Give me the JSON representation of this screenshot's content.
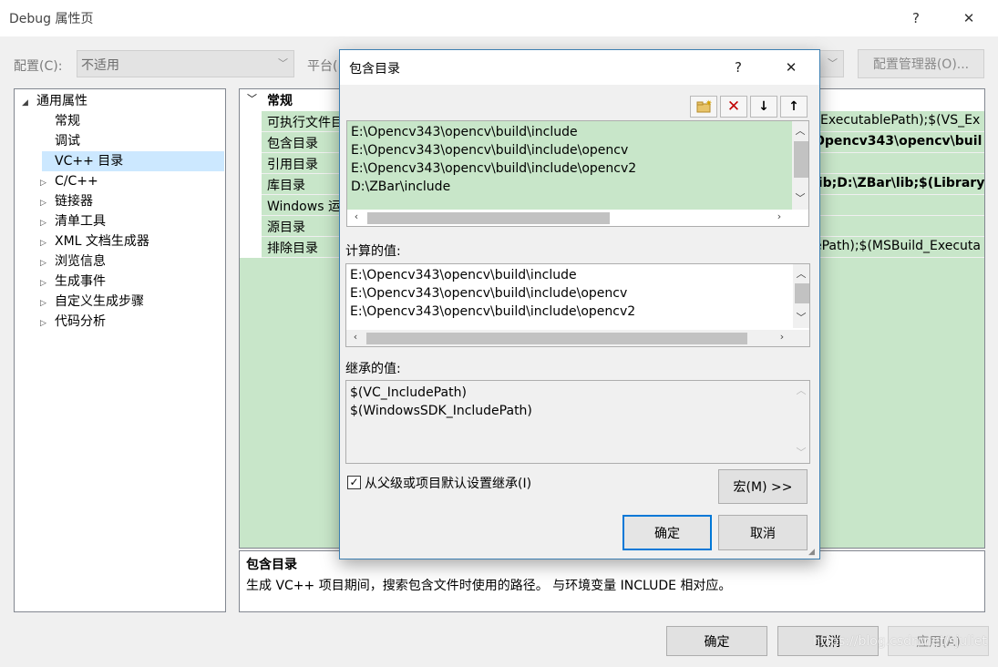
{
  "window": {
    "title": "Debug 属性页",
    "help_glyph": "?",
    "close_glyph": "✕"
  },
  "top_bar": {
    "config_label": "配置(C):",
    "config_value": "不适用",
    "platform_label": "平台(",
    "config_manager": "配置管理器(O)..."
  },
  "tree": {
    "root": "通用属性",
    "items": [
      {
        "label": "常规"
      },
      {
        "label": "调试"
      },
      {
        "label": "VC++ 目录"
      },
      {
        "label": "C/C++"
      },
      {
        "label": "链接器"
      },
      {
        "label": "清单工具"
      },
      {
        "label": "XML 文档生成器"
      },
      {
        "label": "浏览信息"
      },
      {
        "label": "生成事件"
      },
      {
        "label": "自定义生成步骤"
      },
      {
        "label": "代码分析"
      }
    ]
  },
  "grid": {
    "category": "常规",
    "rows": [
      {
        "name": "可执行文件目",
        "value": "_ExecutablePath);$(VS_Ex"
      },
      {
        "name": "包含目录",
        "value": "Opencv343\\opencv\\buil"
      },
      {
        "name": "引用目录",
        "value": ""
      },
      {
        "name": "库目录",
        "value": "lib;D:\\ZBar\\lib;$(LibraryPa"
      },
      {
        "name": "Windows 运",
        "value": ""
      },
      {
        "name": "源目录",
        "value": ""
      },
      {
        "name": "排除目录",
        "value": "ePath);$(MSBuild_Executa"
      }
    ]
  },
  "description": {
    "title": "包含目录",
    "text": "生成 VC++ 项目期间，搜索包含文件时使用的路径。 与环境变量 INCLUDE 相对应。"
  },
  "bottom_buttons": {
    "ok": "确定",
    "cancel": "取消",
    "apply": "应用(A)"
  },
  "watermark": "https://blog.csdn.net/sjuliet",
  "dialog": {
    "title": "包含目录",
    "help_glyph": "?",
    "close_glyph": "✕",
    "toolbar_icons": [
      "new-line-icon",
      "delete-icon",
      "move-down-icon",
      "move-up-icon"
    ],
    "entries": [
      "E:\\Opencv343\\opencv\\build\\include",
      "E:\\Opencv343\\opencv\\build\\include\\opencv",
      "E:\\Opencv343\\opencv\\build\\include\\opencv2",
      "D:\\ZBar\\include"
    ],
    "evaluated_label": "计算的值:",
    "evaluated": [
      "E:\\Opencv343\\opencv\\build\\include",
      "E:\\Opencv343\\opencv\\build\\include\\opencv",
      "E:\\Opencv343\\opencv\\build\\include\\opencv2"
    ],
    "inherited_label": "继承的值:",
    "inherited": [
      "$(VC_IncludePath)",
      "$(WindowsSDK_IncludePath)"
    ],
    "inherit_checkbox_label": "从父级或项目默认设置继承(I)",
    "inherit_checked": true,
    "macros_button": "宏(M) >>",
    "ok": "确定",
    "cancel": "取消"
  },
  "colors": {
    "selection_green": "#c8e6c9",
    "tree_selection": "#cce8ff",
    "accent_blue": "#0078d7"
  }
}
